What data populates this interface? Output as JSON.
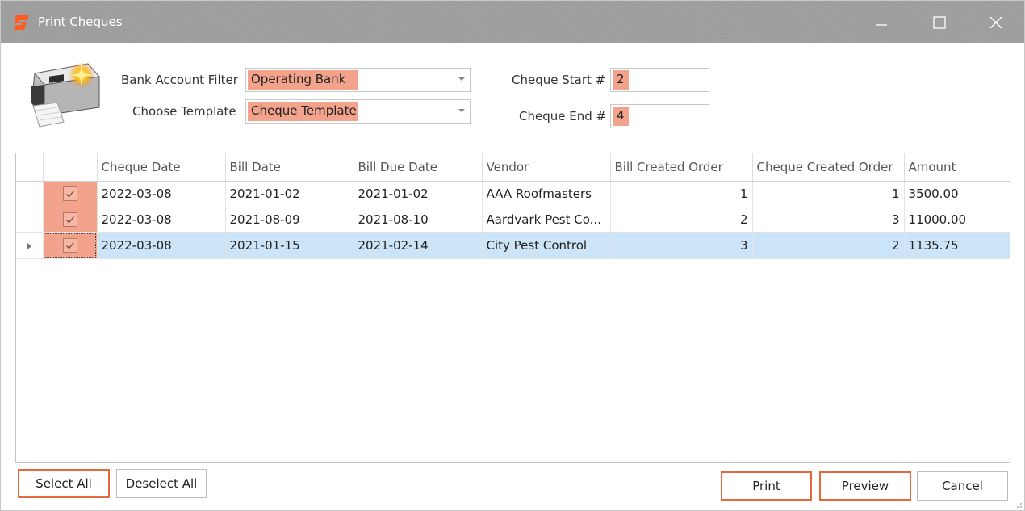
{
  "window": {
    "title": "Print Cheques",
    "accent": "#e46a3c",
    "highlight": "#f3a38b"
  },
  "filters": {
    "bank_account_label": "Bank Account Filter",
    "bank_account_value": "Operating Bank",
    "template_label": "Choose Template",
    "template_value": "Cheque Template",
    "cheque_start_label": "Cheque Start #",
    "cheque_start_value": "2",
    "cheque_end_label": "Cheque End #",
    "cheque_end_value": "4"
  },
  "grid": {
    "columns": [
      "Cheque Date",
      "Bill Date",
      "Bill Due Date",
      "Vendor",
      "Bill Created Order",
      "Cheque Created Order",
      "Amount"
    ],
    "rows": [
      {
        "checked": true,
        "cheque_date": "2022-03-08",
        "bill_date": "2021-01-02",
        "bill_due_date": "2021-01-02",
        "vendor": "AAA Roofmasters",
        "bill_created_order": "1",
        "cheque_created_order": "1",
        "amount": "3500.00"
      },
      {
        "checked": true,
        "cheque_date": "2022-03-08",
        "bill_date": "2021-08-09",
        "bill_due_date": "2021-08-10",
        "vendor": "Aardvark Pest Co...",
        "bill_created_order": "2",
        "cheque_created_order": "3",
        "amount": "11000.00"
      },
      {
        "checked": true,
        "cheque_date": "2022-03-08",
        "bill_date": "2021-01-15",
        "bill_due_date": "2021-02-14",
        "vendor": "City Pest Control",
        "bill_created_order": "3",
        "cheque_created_order": "2",
        "amount": "1135.75"
      }
    ]
  },
  "buttons": {
    "select_all": "Select All",
    "deselect_all": "Deselect All",
    "print": "Print",
    "preview": "Preview",
    "cancel": "Cancel"
  }
}
